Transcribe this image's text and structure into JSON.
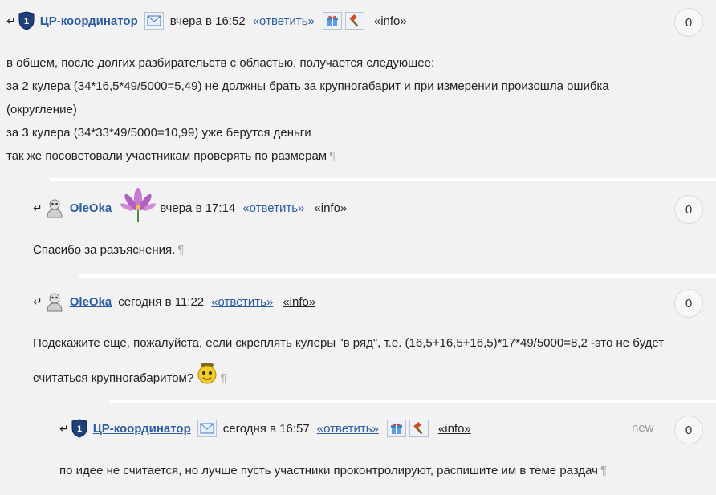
{
  "comments": [
    {
      "author": "ЦР-координатор",
      "date": "вчера в 16:52",
      "reply": "«ответить»",
      "info": "«info»",
      "score": "0",
      "lines": [
        "в общем, после долгих разбирательств с областью, получается следующее:",
        "за 2 кулера (34*16,5*49/5000=5,49) не должны брать за крупногабарит и при измерении произошла ошибка",
        "(округление)",
        "за 3 кулера (34*33*49/5000=10,99) уже берутся деньги",
        "так же посоветовали участникам проверять по размерам"
      ]
    },
    {
      "author": "OleOka",
      "date": "вчера в 17:14",
      "reply": "«ответить»",
      "info": "«info»",
      "score": "0",
      "lines": [
        "Спасибо за разъяснения."
      ]
    },
    {
      "author": "OleOka",
      "date": "сегодня в 11:22",
      "reply": "«ответить»",
      "info": "«info»",
      "score": "0",
      "lines": [
        "Подскажите еще, пожалуйста, если скреплять кулеры \"в ряд\", т.е. (16,5+16,5+16,5)*17*49/5000=8,2 -это не будет",
        "считаться крупногабаритом?"
      ]
    },
    {
      "author": "ЦР-координатор",
      "date": "сегодня в 16:57",
      "reply": "«ответить»",
      "info": "«info»",
      "score": "0",
      "new": "new",
      "lines": [
        "по идее не считается, но лучше пусть участники проконтролируют, распишите им в теме раздач"
      ]
    }
  ],
  "symbols": {
    "reply_arrow": "↵",
    "pilcrow": "¶",
    "badge_number": "1"
  },
  "colors": {
    "background": "#f2f2f2",
    "link": "#2a5d9f",
    "separator": "#ffffff"
  },
  "icons": [
    "coordinator-badge-icon",
    "mail-icon",
    "gift-icon",
    "hammer-icon",
    "user-avatar-icon",
    "flower-avatar-icon",
    "smiley-icon"
  ]
}
